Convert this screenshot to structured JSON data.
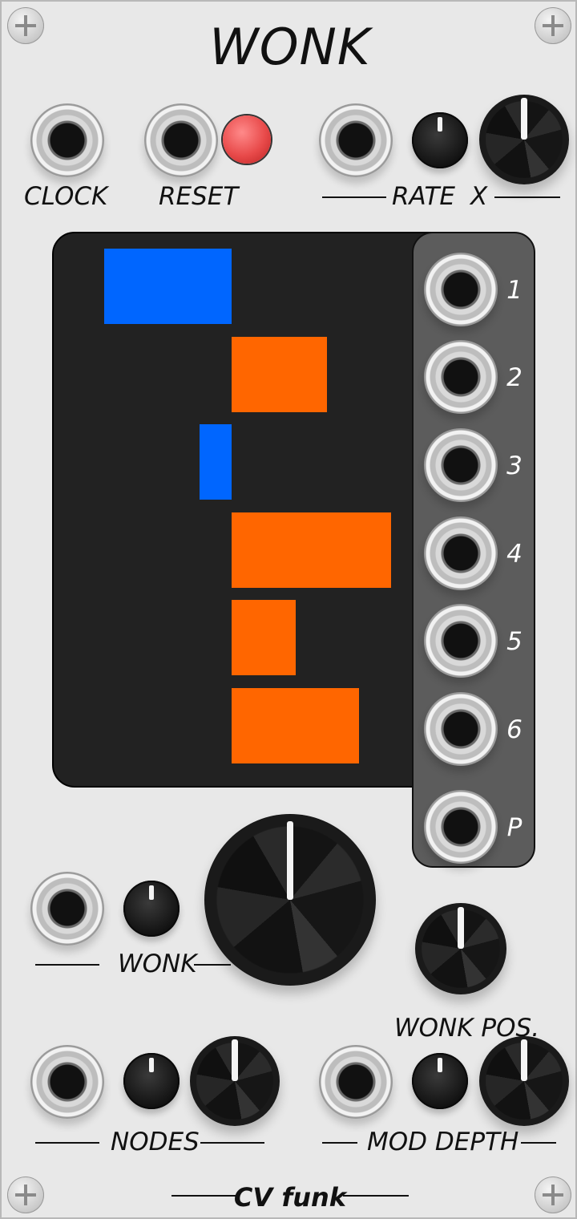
{
  "module": {
    "title": "WONK",
    "brand": "CV funk"
  },
  "labels": {
    "clock": "CLOCK",
    "reset": "RESET",
    "rate": "RATE",
    "rate_x": "X",
    "wonk": "WONK",
    "wonk_pos": "WONK POS.",
    "nodes": "NODES",
    "mod_depth": "MOD DEPTH"
  },
  "outputs": [
    "1",
    "2",
    "3",
    "4",
    "5",
    "6",
    "P"
  ],
  "colors": {
    "positive": "#ff6600",
    "negative": "#0066ff",
    "display_bg": "#222222",
    "led": "#e84a4a"
  },
  "display_values": [
    -0.8,
    0.6,
    -0.2,
    1.0,
    0.4,
    0.8
  ]
}
